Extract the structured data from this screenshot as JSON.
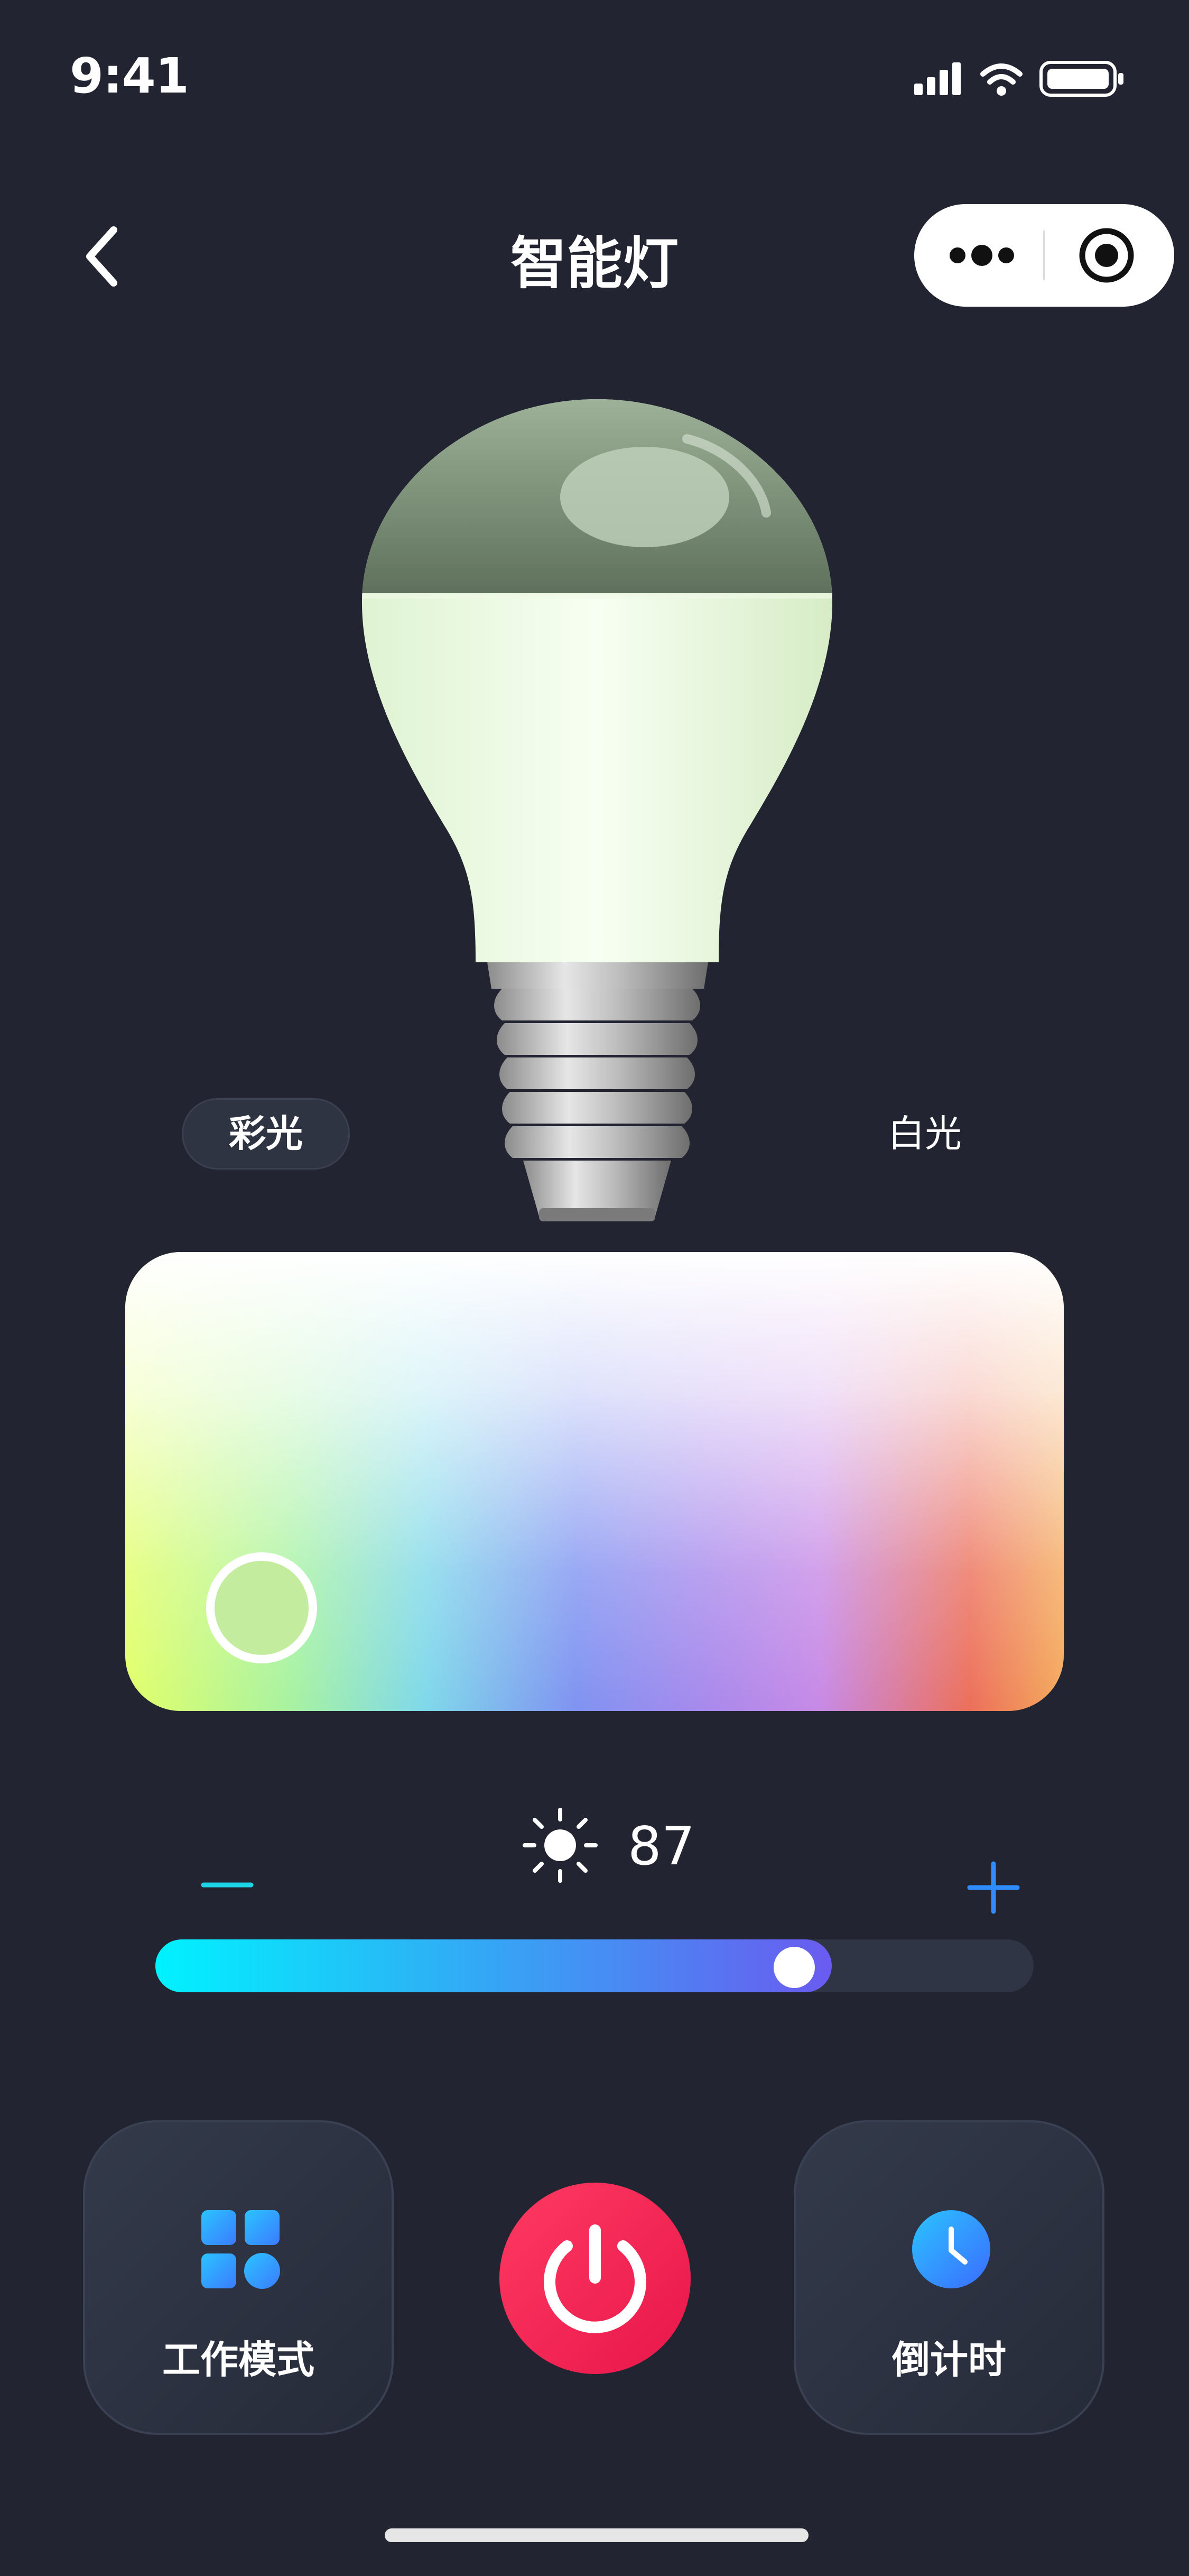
{
  "status_bar": {
    "time": "9:41"
  },
  "nav": {
    "title": "智能灯"
  },
  "mode_switch": {
    "color_label": "彩光",
    "white_label": "白光",
    "selected": "彩光"
  },
  "brightness": {
    "value": "87",
    "level_percent": 77
  },
  "bottom_actions": {
    "work_mode_label": "工作模式",
    "timer_label": "倒计时"
  },
  "colors": {
    "background": "#222531",
    "power_button": "#f0214f",
    "accent_blue": "#2f8cff",
    "accent_cyan": "#00f2ff",
    "picker_selected": "#c3ec9e"
  },
  "icons": {
    "back": "chevron-left-icon",
    "more": "more-dots-icon",
    "close": "target-icon",
    "brightness": "sun-icon",
    "work_mode": "grid-icon",
    "timer": "clock-icon",
    "power": "power-icon"
  }
}
